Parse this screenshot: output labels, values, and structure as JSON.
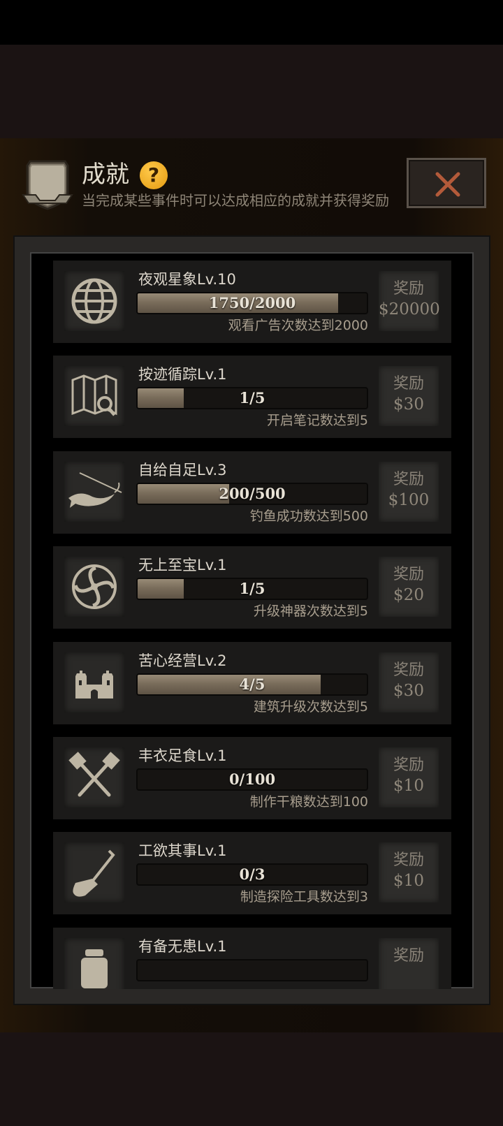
{
  "header": {
    "title": "成就",
    "help_glyph": "?",
    "subtitle": "当完成某些事件时可以达成相应的成就并获得奖励",
    "close_icon": "close-x-icon",
    "accent_color": "#f0a820",
    "close_color": "#b35a3a"
  },
  "achievements": [
    {
      "icon": "globe-icon",
      "title": "夜观星象Lv.10",
      "progress_text": "1750/2000",
      "progress": 0.875,
      "desc": "观看广告次数达到2000",
      "reward_label": "奖励",
      "reward_value": "$20000"
    },
    {
      "icon": "map-search-icon",
      "title": "按迹循踪Lv.1",
      "progress_text": "1/5",
      "progress": 0.2,
      "desc": "开启笔记数达到5",
      "reward_label": "奖励",
      "reward_value": "$30"
    },
    {
      "icon": "fishing-icon",
      "title": "自给自足Lv.3",
      "progress_text": "200/500",
      "progress": 0.4,
      "desc": "钓鱼成功数达到500",
      "reward_label": "奖励",
      "reward_value": "$100"
    },
    {
      "icon": "ornament-icon",
      "title": "无上至宝Lv.1",
      "progress_text": "1/5",
      "progress": 0.2,
      "desc": "升级神器次数达到5",
      "reward_label": "奖励",
      "reward_value": "$20"
    },
    {
      "icon": "castle-icon",
      "title": "苦心经营Lv.2",
      "progress_text": "4/5",
      "progress": 0.8,
      "desc": "建筑升级次数达到5",
      "reward_label": "奖励",
      "reward_value": "$30"
    },
    {
      "icon": "crossed-spatulas-icon",
      "title": "丰衣足食Lv.1",
      "progress_text": "0/100",
      "progress": 0,
      "desc": "制作干粮数达到100",
      "reward_label": "奖励",
      "reward_value": "$10"
    },
    {
      "icon": "shovel-icon",
      "title": "工欲其事Lv.1",
      "progress_text": "0/3",
      "progress": 0,
      "desc": "制造探险工具数达到3",
      "reward_label": "奖励",
      "reward_value": "$10"
    },
    {
      "icon": "jar-icon",
      "title": "有备无患Lv.1",
      "progress_text": "",
      "progress": 0,
      "desc": "",
      "reward_label": "奖励",
      "reward_value": ""
    }
  ]
}
